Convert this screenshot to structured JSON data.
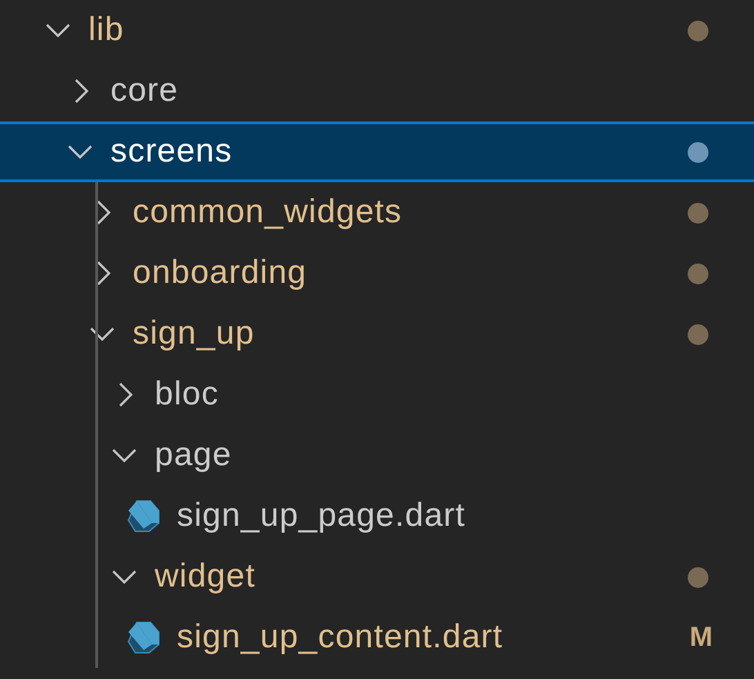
{
  "explorer": {
    "tree": [
      {
        "name": "lib",
        "kind": "folder",
        "expanded": true,
        "modified": true,
        "selected": false,
        "dot": true,
        "children": [
          {
            "name": "core",
            "kind": "folder",
            "expanded": false,
            "modified": false,
            "selected": false
          },
          {
            "name": "screens",
            "kind": "folder",
            "expanded": true,
            "modified": true,
            "selected": true,
            "dot": true,
            "children": [
              {
                "name": "common_widgets",
                "kind": "folder",
                "expanded": false,
                "modified": true,
                "selected": false,
                "dot": true
              },
              {
                "name": "onboarding",
                "kind": "folder",
                "expanded": false,
                "modified": true,
                "selected": false,
                "dot": true
              },
              {
                "name": "sign_up",
                "kind": "folder",
                "expanded": true,
                "modified": true,
                "selected": false,
                "dot": true,
                "children": [
                  {
                    "name": "bloc",
                    "kind": "folder",
                    "expanded": false,
                    "modified": false,
                    "selected": false
                  },
                  {
                    "name": "page",
                    "kind": "folder",
                    "expanded": true,
                    "modified": false,
                    "selected": false,
                    "children": [
                      {
                        "name": "sign_up_page.dart",
                        "kind": "file",
                        "modified": false,
                        "selected": false
                      }
                    ]
                  },
                  {
                    "name": "widget",
                    "kind": "folder",
                    "expanded": true,
                    "modified": true,
                    "selected": false,
                    "dot": true,
                    "children": [
                      {
                        "name": "sign_up_content.dart",
                        "kind": "file",
                        "modified": true,
                        "selected": false,
                        "badge": "M"
                      }
                    ]
                  }
                ]
              }
            ]
          }
        ]
      }
    ]
  }
}
